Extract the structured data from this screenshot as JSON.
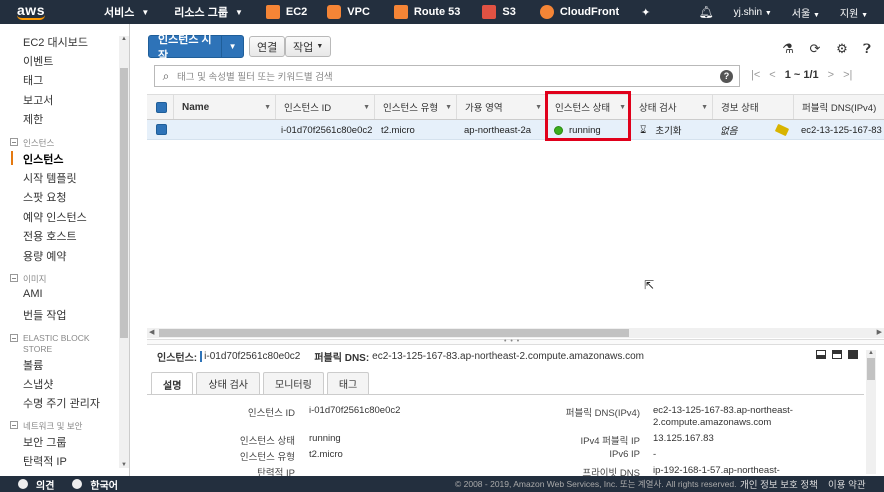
{
  "topbar": {
    "logo": "aws",
    "services": "서비스",
    "resource_groups": "리소스 그룹",
    "shortcuts": [
      {
        "label": "EC2",
        "color": "#f58536"
      },
      {
        "label": "VPC",
        "color": "#f58536"
      },
      {
        "label": "Route 53",
        "color": "#f58536"
      },
      {
        "label": "S3",
        "color": "#e05243"
      },
      {
        "label": "CloudFront",
        "color": "#f58536"
      }
    ],
    "user": "yj.shin",
    "region": "서울",
    "support": "지원"
  },
  "sidebar": {
    "items": [
      {
        "label": "EC2 대시보드"
      },
      {
        "label": "이벤트"
      },
      {
        "label": "태그"
      },
      {
        "label": "보고서"
      },
      {
        "label": "제한"
      }
    ],
    "sections": [
      {
        "title": "인스턴스",
        "items": [
          "인스턴스",
          "시작 템플릿",
          "스팟 요청",
          "예약 인스턴스",
          "전용 호스트",
          "용량 예약"
        ]
      },
      {
        "title": "이미지",
        "items": [
          "AMI",
          "번들 작업"
        ]
      },
      {
        "title": "ELASTIC BLOCK STORE",
        "items": [
          "볼륨",
          "스냅샷",
          "수명 주기 관리자"
        ]
      },
      {
        "title": "네트워크 및 보안",
        "items": [
          "보안 그룹",
          "탄력적 IP"
        ]
      }
    ],
    "active_item": "인스턴스"
  },
  "toolbar": {
    "launch_label": "인스턴스 시작",
    "connect_label": "연결",
    "actions_label": "작업"
  },
  "search": {
    "placeholder": "태그 및 속성별 필터 또는 키워드별 검색",
    "pager": "1 ~ 1/1"
  },
  "table": {
    "headers": [
      "Name",
      "인스턴스 ID",
      "인스턴스 유형",
      "가용 영역",
      "인스턴스 상태",
      "상태 검사",
      "경보 상태",
      "퍼블릭 DNS(IPv4)"
    ],
    "row": {
      "name": "",
      "instance_id": "i-01d70f2561c80e0c2",
      "type": "t2.micro",
      "az": "ap-northeast-2a",
      "state": "running",
      "status_check": "초기화",
      "alarm": "없음",
      "public_dns": "ec2-13-125-167-83"
    }
  },
  "detail": {
    "instance_label": "인스턴스:",
    "instance_id": "i-01d70f2561c80e0c2",
    "dns_label": "퍼블릭 DNS:",
    "dns_value": "ec2-13-125-167-83.ap-northeast-2.compute.amazonaws.com",
    "tabs": [
      "설명",
      "상태 검사",
      "모니터링",
      "태그"
    ],
    "left_fields": [
      {
        "key": "인스턴스 ID",
        "value": "i-01d70f2561c80e0c2"
      },
      {
        "key": "인스턴스 상태",
        "value": "running"
      },
      {
        "key": "인스턴스 유형",
        "value": "t2.micro"
      },
      {
        "key": "탄력적 IP",
        "value": ""
      }
    ],
    "right_fields": [
      {
        "key": "퍼블릭 DNS(IPv4)",
        "value": "ec2-13-125-167-83.ap-northeast-2.compute.amazonaws.com",
        "value_line1": "ec2-13-125-167-83.ap-northeast-",
        "value_line2": "2.compute.amazonaws.com"
      },
      {
        "key": "IPv4 퍼블릭 IP",
        "value": "13.125.167.83"
      },
      {
        "key": "IPv6 IP",
        "value": "-"
      },
      {
        "key": "프라이빗 DNS",
        "value": "ip-192-168-1-57.ap-northeast-"
      }
    ]
  },
  "footer": {
    "feedback": "의견",
    "language": "한국어",
    "copyright": "© 2008 - 2019, Amazon Web Services, Inc. 또는 계열사. All rights reserved.",
    "privacy": "개인 정보 보호 정책",
    "terms": "이용 약관"
  },
  "colors": {
    "nav_bg": "#232f3e",
    "primary": "#2e73b8",
    "running": "#3cae1d",
    "highlight": "#e0001b",
    "active_accent": "#e47911"
  }
}
